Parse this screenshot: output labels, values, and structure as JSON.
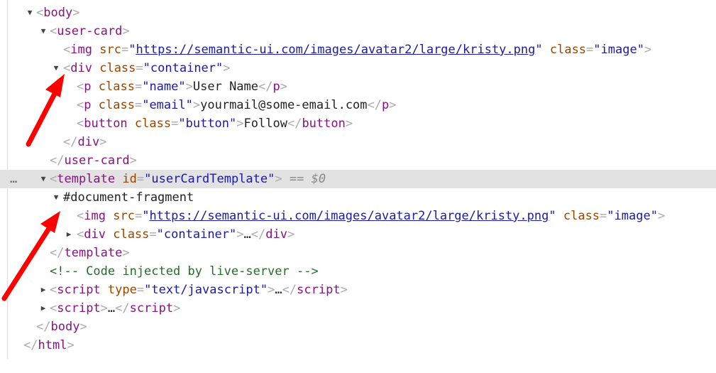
{
  "nodes": {
    "body_open": "body",
    "user_card_open": "user-card",
    "img1": {
      "tag": "img",
      "src_attr": "src",
      "src": "https://semantic-ui.com/images/avatar2/large/kristy.png",
      "class_attr": "class",
      "class": "image"
    },
    "div1": {
      "tag": "div",
      "class_attr": "class",
      "class": "container"
    },
    "p_name": {
      "tag": "p",
      "class_attr": "class",
      "class": "name",
      "text": "User Name"
    },
    "p_email": {
      "tag": "p",
      "class_attr": "class",
      "class": "email",
      "text": "yourmail@some-email.com"
    },
    "button": {
      "tag": "button",
      "class_attr": "class",
      "class": "button",
      "text": "Follow"
    },
    "div_close": "div",
    "user_card_close": "user-card",
    "template": {
      "tag": "template",
      "id_attr": "id",
      "id": "userCardTemplate",
      "marker": "== $0"
    },
    "fragment": "#document-fragment",
    "img2": {
      "tag": "img",
      "src_attr": "src",
      "src": "https://semantic-ui.com/images/avatar2/large/kristy.png",
      "class_attr": "class",
      "class": "image"
    },
    "div2": {
      "tag": "div",
      "class_attr": "class",
      "class": "container",
      "ellipsis": "…"
    },
    "template_close": "template",
    "comment": "<!-- Code injected by live-server -->",
    "script1": {
      "tag": "script",
      "type_attr": "type",
      "type": "text/javascript",
      "ellipsis": "…"
    },
    "script2": {
      "tag": "script",
      "ellipsis": "…"
    },
    "body_close": "body",
    "html_close": "html"
  },
  "ui": {
    "row_menu": "…",
    "arrow_color": "#ff0000"
  }
}
